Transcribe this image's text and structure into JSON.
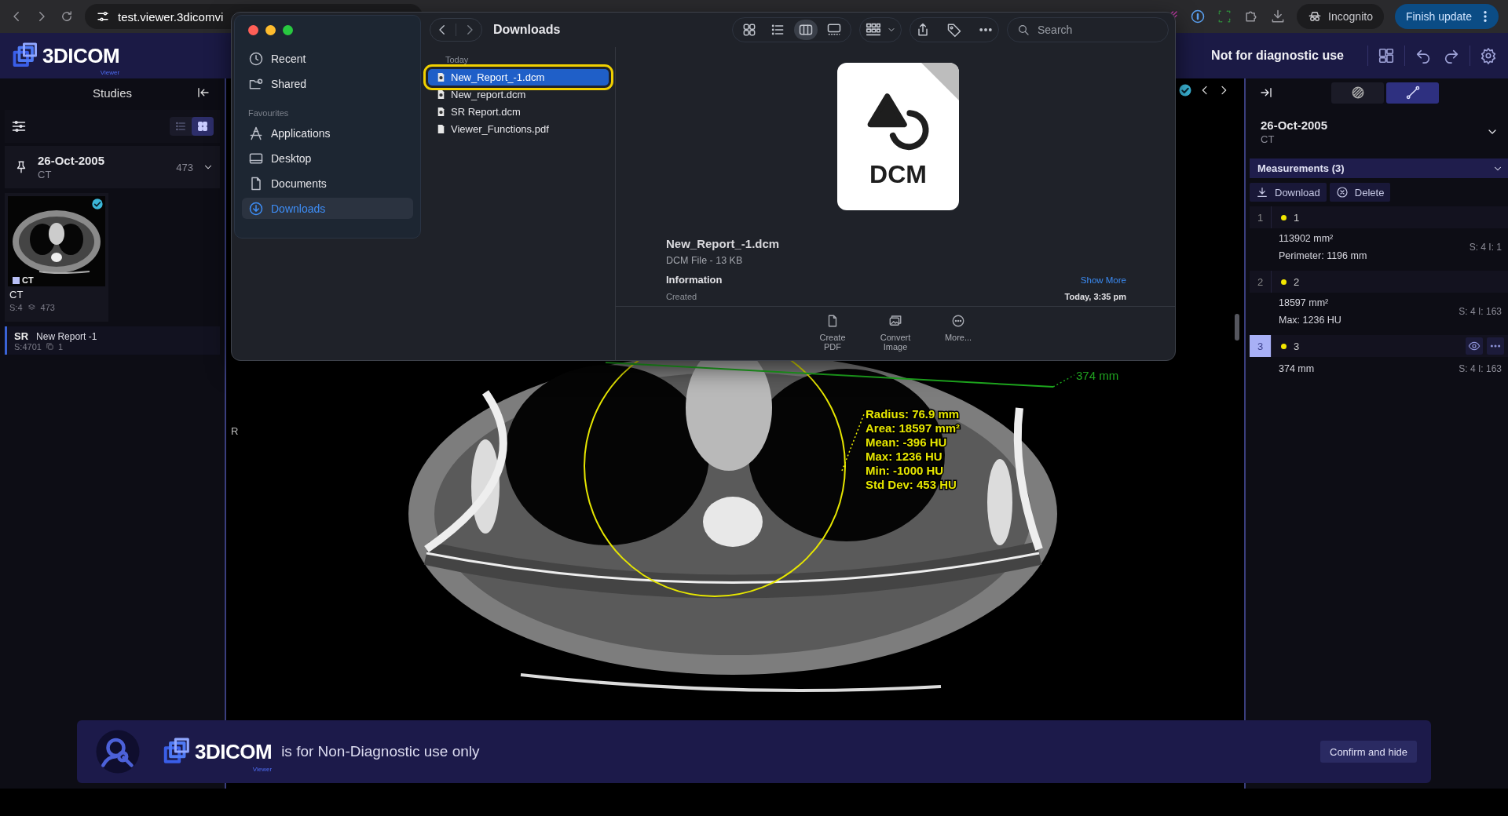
{
  "browser": {
    "url": "test.viewer.3dicomvi",
    "incognito": "Incognito",
    "update_button": "Finish update"
  },
  "header": {
    "logo": {
      "name": "3DICOM",
      "sub": "Viewer"
    },
    "notice": "Not for diagnostic use"
  },
  "sidebar": {
    "title": "Studies",
    "view_modes": [
      {
        "kind": "list",
        "selected": false
      },
      {
        "kind": "grid",
        "selected": true
      }
    ],
    "study": {
      "date": "26-Oct-2005",
      "modality": "CT",
      "count": "473"
    },
    "series": [
      {
        "tag": "CT",
        "title": "CT",
        "number": "S:4",
        "images": "473",
        "checked": true
      }
    ],
    "reports": [
      {
        "tag": "SR",
        "title": "New Report -1",
        "number": "S:4701",
        "count": "1"
      }
    ]
  },
  "viewport": {
    "checked": true,
    "orientation": "R",
    "line_label": "374 mm",
    "roi_stats": [
      "Radius: 76.9 mm",
      "Area: 18597 mm²",
      "Mean: -396 HU",
      "Max: 1236 HU",
      "Min: -1000 HU",
      "Std Dev: 453 HU"
    ]
  },
  "panel": {
    "tools": [
      {
        "kind": "segment",
        "selected": false
      },
      {
        "kind": "measure",
        "selected": true
      }
    ],
    "study": {
      "date": "26-Oct-2005",
      "modality": "CT"
    },
    "measurements": {
      "title": "Measurements (3)",
      "actions": [
        {
          "kind": "download",
          "label": "Download"
        },
        {
          "kind": "delete",
          "label": "Delete"
        }
      ],
      "items": [
        {
          "index": "1",
          "label": "1",
          "lines": [
            "113902 mm²",
            "Perimeter: 1196 mm"
          ],
          "location": "S: 4 I: 1",
          "selected": false
        },
        {
          "index": "2",
          "label": "2",
          "lines": [
            "18597 mm²",
            "Max: 1236 HU"
          ],
          "location": "S: 4 I: 163",
          "selected": false
        },
        {
          "index": "3",
          "label": "3",
          "lines": [
            "374 mm"
          ],
          "location": "S: 4 I: 163",
          "selected": true
        }
      ]
    }
  },
  "banner": {
    "logo": {
      "name": "3DICOM",
      "sub": "Viewer"
    },
    "text": "is for Non-Diagnostic use only",
    "button": "Confirm and hide"
  },
  "dialog": {
    "title": "Downloads",
    "places": [
      {
        "kind": "clock",
        "label": "Recent",
        "selected": false
      },
      {
        "kind": "shared",
        "label": "Shared",
        "selected": false
      }
    ],
    "favourites_title": "Favourites",
    "favourites": [
      {
        "kind": "apps",
        "label": "Applications",
        "selected": false
      },
      {
        "kind": "desktop",
        "label": "Desktop",
        "selected": false
      },
      {
        "kind": "document",
        "label": "Documents",
        "selected": false
      },
      {
        "kind": "download",
        "label": "Downloads",
        "selected": true
      }
    ],
    "view_modes": [
      {
        "kind": "icons",
        "selected": false
      },
      {
        "kind": "list",
        "selected": false
      },
      {
        "kind": "columns",
        "selected": true
      },
      {
        "kind": "gallery",
        "selected": false
      }
    ],
    "search": {
      "placeholder": "Search"
    },
    "group": "Today",
    "files": [
      {
        "name": "New_Report_-1.dcm",
        "kind": "dcm",
        "selected": true,
        "highlighted": true
      },
      {
        "name": "New_report.dcm",
        "kind": "dcm",
        "selected": false,
        "highlighted": false
      },
      {
        "name": "SR Report.dcm",
        "kind": "dcm",
        "selected": false,
        "highlighted": false
      },
      {
        "name": "Viewer_Functions.pdf",
        "kind": "pdf",
        "selected": false,
        "highlighted": false
      }
    ],
    "preview": {
      "badge": "DCM",
      "name": "New_Report_-1.dcm",
      "info": "DCM File - 13 KB",
      "section": "Information",
      "show_more": "Show More",
      "created_label": "Created",
      "created_value": "Today, 3:35 pm"
    },
    "actions": [
      {
        "kind": "pdf",
        "label": "Create PDF"
      },
      {
        "kind": "image",
        "label": "Convert Image"
      },
      {
        "kind": "more",
        "label": "More..."
      }
    ]
  }
}
